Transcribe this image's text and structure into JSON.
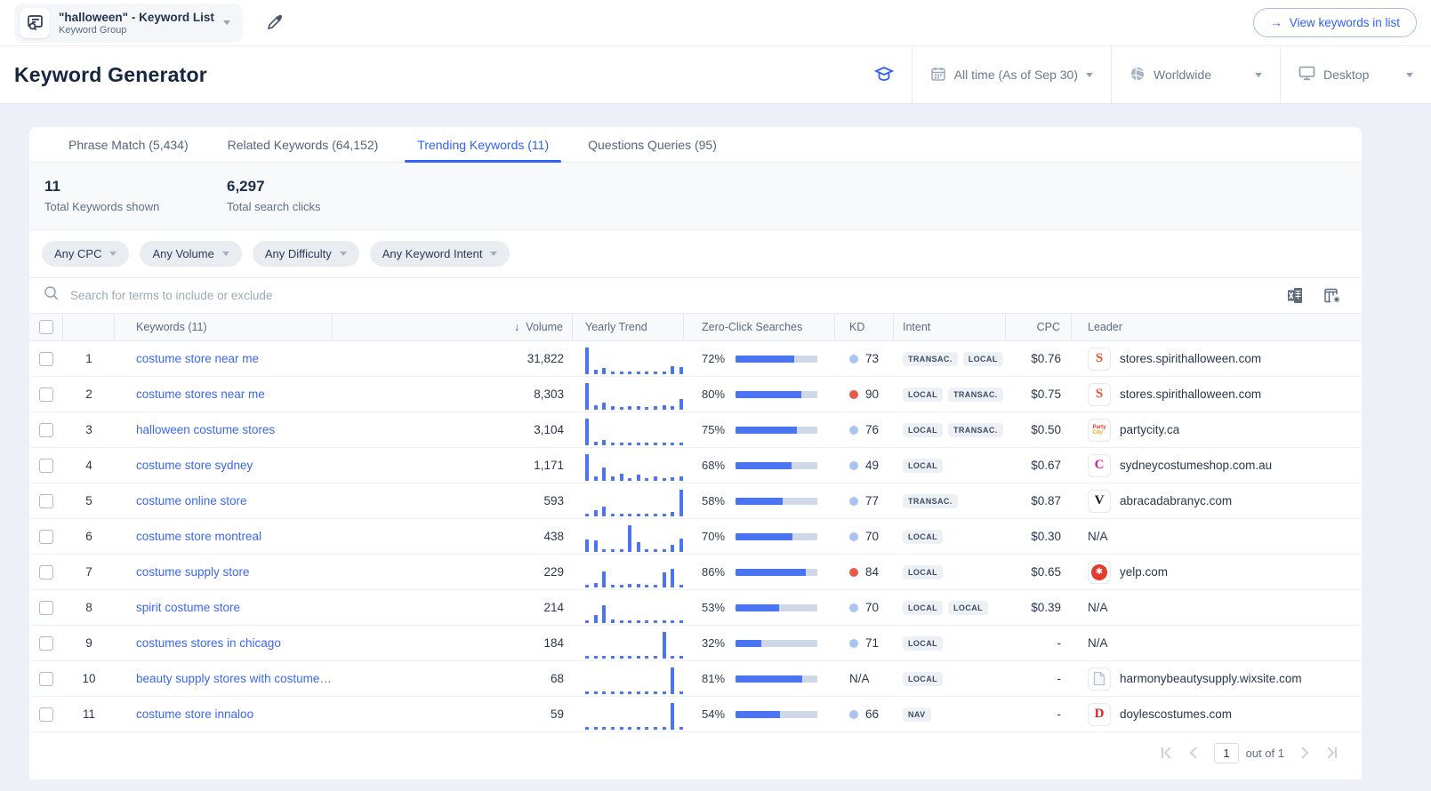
{
  "topbar": {
    "group_title": "\"halloween\" - Keyword List",
    "group_subtitle": "Keyword Group",
    "view_button": "View keywords in list"
  },
  "header": {
    "title": "Keyword Generator",
    "date_selector": "All time (As of Sep 30)",
    "region_selector": "Worldwide",
    "device_selector": "Desktop"
  },
  "tabs": [
    {
      "label": "Phrase Match (5,434)",
      "active": false
    },
    {
      "label": "Related Keywords (64,152)",
      "active": false
    },
    {
      "label": "Trending Keywords (11)",
      "active": true
    },
    {
      "label": "Questions Queries (95)",
      "active": false
    }
  ],
  "stats": [
    {
      "value": "11",
      "label": "Total Keywords shown"
    },
    {
      "value": "6,297",
      "label": "Total search clicks"
    }
  ],
  "filters": {
    "cpc": "Any CPC",
    "volume": "Any Volume",
    "difficulty": "Any Difficulty",
    "intent": "Any Keyword Intent"
  },
  "search": {
    "placeholder": "Search for terms to include or exclude"
  },
  "icons": {
    "arrow_right": "→",
    "sort_desc": "↓"
  },
  "colors": {
    "accent": "#2f62f4",
    "trend_bar": "#4a74f2",
    "kd_light": "#a9c3f2",
    "kd_red": "#e85948"
  },
  "table": {
    "header": {
      "keywords": "Keywords (11)",
      "volume": "Volume",
      "yearly_trend": "Yearly Trend",
      "zero_click": "Zero-Click Searches",
      "kd": "KD",
      "intent": "Intent",
      "cpc": "CPC",
      "leader": "Leader"
    },
    "rows": [
      {
        "num": "1",
        "keyword": "costume store near me",
        "volume": "31,822",
        "trend": [
          1,
          0.15,
          0.22,
          0.08,
          0.08,
          0.08,
          0.08,
          0.08,
          0.08,
          0.1,
          0.3,
          0.25
        ],
        "zero_click": "72%",
        "zero_click_pct": 72,
        "kd": "73",
        "kd_color": "light",
        "intents": [
          "TRANSAC.",
          "LOCAL"
        ],
        "cpc": "$0.76",
        "leader": "stores.spirithalloween.com",
        "favicon": {
          "type": "letter",
          "text": "S",
          "color": "#e8542e"
        }
      },
      {
        "num": "2",
        "keyword": "costume stores near me",
        "volume": "8,303",
        "trend": [
          1,
          0.15,
          0.25,
          0.12,
          0.08,
          0.12,
          0.12,
          0.08,
          0.12,
          0.18,
          0.12,
          0.4
        ],
        "zero_click": "80%",
        "zero_click_pct": 80,
        "kd": "90",
        "kd_color": "red",
        "intents": [
          "LOCAL",
          "TRANSAC."
        ],
        "cpc": "$0.75",
        "leader": "stores.spirithalloween.com",
        "favicon": {
          "type": "letter",
          "text": "S",
          "color": "#e8542e"
        }
      },
      {
        "num": "3",
        "keyword": "halloween costume stores",
        "volume": "3,104",
        "trend": [
          1,
          0.12,
          0.2,
          0.06,
          0.06,
          0.06,
          0.06,
          0.06,
          0.06,
          0.06,
          0.06,
          0.06
        ],
        "zero_click": "75%",
        "zero_click_pct": 75,
        "kd": "76",
        "kd_color": "light",
        "intents": [
          "LOCAL",
          "TRANSAC."
        ],
        "cpc": "$0.50",
        "leader": "partycity.ca",
        "favicon": {
          "type": "stacked",
          "lines": [
            "Party",
            "City"
          ],
          "line_colors": [
            "#e23a2e",
            "#f0a818"
          ]
        }
      },
      {
        "num": "4",
        "keyword": "costume store sydney",
        "volume": "1,171",
        "trend": [
          1,
          0.18,
          0.5,
          0.18,
          0.28,
          0.1,
          0.22,
          0.08,
          0.15,
          0.1,
          0.12,
          0.15
        ],
        "zero_click": "68%",
        "zero_click_pct": 68,
        "kd": "49",
        "kd_color": "light",
        "intents": [
          "LOCAL"
        ],
        "cpc": "$0.67",
        "leader": "sydneycostumeshop.com.au",
        "favicon": {
          "type": "letter",
          "text": "C",
          "color": "#d6219c"
        }
      },
      {
        "num": "5",
        "keyword": "costume online store",
        "volume": "593",
        "trend": [
          0.1,
          0.22,
          0.35,
          0.1,
          0.06,
          0.06,
          0.06,
          0.06,
          0.06,
          0.1,
          0.18,
          1
        ],
        "zero_click": "58%",
        "zero_click_pct": 58,
        "kd": "77",
        "kd_color": "light",
        "intents": [
          "TRANSAC."
        ],
        "cpc": "$0.87",
        "leader": "abracadabranyc.com",
        "favicon": {
          "type": "letter",
          "text": "V",
          "color": "#1a1a1a"
        }
      },
      {
        "num": "6",
        "keyword": "costume store montreal",
        "volume": "438",
        "trend": [
          0.45,
          0.42,
          0.06,
          0.1,
          0.06,
          1,
          0.35,
          0.1,
          0.06,
          0.06,
          0.28,
          0.5
        ],
        "zero_click": "70%",
        "zero_click_pct": 70,
        "kd": "70",
        "kd_color": "light",
        "intents": [
          "LOCAL"
        ],
        "cpc": "$0.30",
        "leader": "N/A",
        "favicon": null
      },
      {
        "num": "7",
        "keyword": "costume supply store",
        "volume": "229",
        "trend": [
          0.1,
          0.18,
          0.6,
          0.06,
          0.06,
          0.12,
          0.12,
          0.1,
          0.06,
          0.55,
          0.7,
          0.06
        ],
        "zero_click": "86%",
        "zero_click_pct": 86,
        "kd": "84",
        "kd_color": "red",
        "intents": [
          "LOCAL"
        ],
        "cpc": "$0.65",
        "leader": "yelp.com",
        "favicon": {
          "type": "circle",
          "text": "✱",
          "bg": "#e33b2e"
        }
      },
      {
        "num": "8",
        "keyword": "spirit costume store",
        "volume": "214",
        "trend": [
          0.1,
          0.3,
          0.65,
          0.12,
          0.08,
          0.08,
          0.08,
          0.08,
          0.08,
          0.08,
          0.08,
          0.08
        ],
        "zero_click": "53%",
        "zero_click_pct": 53,
        "kd": "70",
        "kd_color": "light",
        "intents": [
          "LOCAL",
          "LOCAL"
        ],
        "cpc": "$0.39",
        "leader": "N/A",
        "favicon": null
      },
      {
        "num": "9",
        "keyword": "costumes stores in chicago",
        "volume": "184",
        "trend": [
          0.06,
          0.06,
          0.06,
          0.06,
          0.06,
          0.06,
          0.06,
          0.06,
          0.06,
          1,
          0.08,
          0.06
        ],
        "zero_click": "32%",
        "zero_click_pct": 32,
        "kd": "71",
        "kd_color": "light",
        "intents": [
          "LOCAL"
        ],
        "cpc": "-",
        "leader": "N/A",
        "favicon": null
      },
      {
        "num": "10",
        "keyword": "beauty supply stores with costume…",
        "volume": "68",
        "trend": [
          0.06,
          0.06,
          0.06,
          0.06,
          0.06,
          0.06,
          0.06,
          0.06,
          0.06,
          0.06,
          1,
          0.08
        ],
        "zero_click": "81%",
        "zero_click_pct": 81,
        "kd": "N/A",
        "kd_color": null,
        "intents": [
          "LOCAL"
        ],
        "cpc": "-",
        "leader": "harmonybeautysupply.wixsite.com",
        "favicon": {
          "type": "doc"
        }
      },
      {
        "num": "11",
        "keyword": "costume store innaloo",
        "volume": "59",
        "trend": [
          0.06,
          0.06,
          0.06,
          0.06,
          0.06,
          0.06,
          0.06,
          0.06,
          0.06,
          0.06,
          1,
          0.08
        ],
        "zero_click": "54%",
        "zero_click_pct": 54,
        "kd": "66",
        "kd_color": "light",
        "intents": [
          "NAV"
        ],
        "cpc": "-",
        "leader": "doylescostumes.com",
        "favicon": {
          "type": "letter",
          "text": "D",
          "color": "#d42027"
        }
      }
    ]
  },
  "pagination": {
    "page": "1",
    "label": "out of 1"
  }
}
